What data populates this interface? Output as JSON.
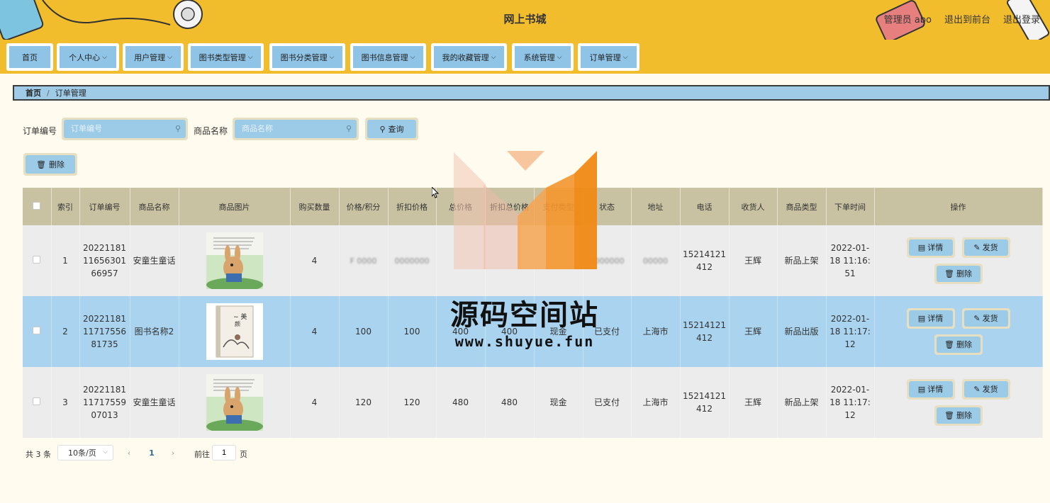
{
  "header": {
    "title": "网上书城",
    "user_label": "管理员 abo",
    "front_link": "退出到前台",
    "logout_link": "退出登录"
  },
  "nav": {
    "items": [
      {
        "label": "首页",
        "has_menu": false
      },
      {
        "label": "个人中心",
        "has_menu": true
      },
      {
        "label": "用户管理",
        "has_menu": true
      },
      {
        "label": "图书类型管理",
        "has_menu": true
      },
      {
        "label": "图书分类管理",
        "has_menu": true
      },
      {
        "label": "图书信息管理",
        "has_menu": true
      },
      {
        "label": "我的收藏管理",
        "has_menu": true
      },
      {
        "label": "系统管理",
        "has_menu": true
      },
      {
        "label": "订单管理",
        "has_menu": true
      }
    ]
  },
  "breadcrumb": {
    "home": "首页",
    "separator": "/",
    "current": "订单管理"
  },
  "search": {
    "order_no_label": "订单编号",
    "order_no_placeholder": "订单编号",
    "product_label": "商品名称",
    "product_placeholder": "商品名称",
    "query_button": "查询"
  },
  "toolbar": {
    "delete_button": "删除"
  },
  "table": {
    "headers": [
      "索引",
      "订单编号",
      "商品名称",
      "商品图片",
      "购买数量",
      "价格/积分",
      "折扣价格",
      "总价格",
      "折扣总价格",
      "支付类型",
      "状态",
      "地址",
      "电话",
      "收货人",
      "商品类型",
      "下单时间",
      "操作"
    ],
    "rows": [
      {
        "index": "1",
        "order_no": "20221181 11656301 66957",
        "product": "安童生童话",
        "qty": "4",
        "price": "",
        "discount_price": "",
        "total": "",
        "discount_total": "",
        "pay_type": "",
        "status": "",
        "address": "",
        "phone": "15214121 412",
        "receiver": "王辉",
        "type": "新品上架",
        "time": "2022-01- 18 11:16: 51",
        "cover": "rabbit"
      },
      {
        "index": "2",
        "order_no": "20221181 11717556 81735",
        "product": "图书名称2",
        "qty": "4",
        "price": "100",
        "discount_price": "100",
        "total": "400",
        "discount_total": "400",
        "pay_type": "现金",
        "status": "已支付",
        "address": "上海市",
        "phone": "15214121 412",
        "receiver": "王辉",
        "type": "新品出版",
        "time": "2022-01- 18 11:17: 12",
        "cover": "book"
      },
      {
        "index": "3",
        "order_no": "20221181 11717559 07013",
        "product": "安童生童话",
        "qty": "4",
        "price": "120",
        "discount_price": "120",
        "total": "480",
        "discount_total": "480",
        "pay_type": "现金",
        "status": "已支付",
        "address": "上海市",
        "phone": "15214121 412",
        "receiver": "王辉",
        "type": "新品上架",
        "time": "2022-01- 18 11:17: 12",
        "cover": "rabbit"
      }
    ],
    "ops": {
      "detail": "详情",
      "ship": "发货",
      "delete": "删除"
    }
  },
  "pagination": {
    "total": "共 3 条",
    "page_size": "10条/页",
    "current_page": "1",
    "goto_label": "前往",
    "goto_value": "1",
    "page_unit": "页"
  },
  "watermark": {
    "name": "源码空间站",
    "url": "www.shuyue.fun"
  },
  "colors": {
    "header_bg": "#f2bd2c",
    "button_blue": "#9ccbe8",
    "highlight_row": "#a9d3ef",
    "table_header": "#c8c2a2",
    "page_bg": "#fffbee"
  }
}
